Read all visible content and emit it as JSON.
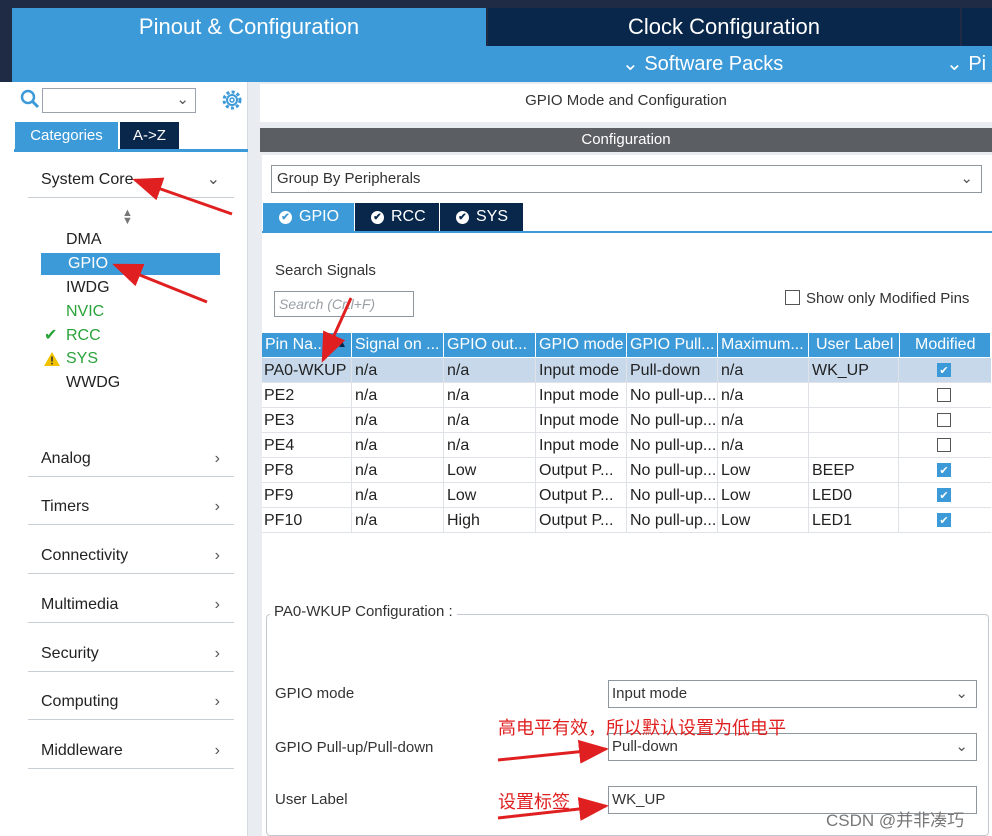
{
  "top_tabs": {
    "pinout": "Pinout & Configuration",
    "clock": "Clock Configuration"
  },
  "sub_bar": {
    "software_packs": "Software Packs",
    "more": "Pi"
  },
  "left": {
    "search_value": "",
    "cat_tabs": [
      "Categories",
      "A->Z"
    ],
    "system_core": "System Core",
    "system_core_items": [
      {
        "label": "DMA",
        "state": "normal"
      },
      {
        "label": "GPIO",
        "state": "selected"
      },
      {
        "label": "IWDG",
        "state": "normal"
      },
      {
        "label": "NVIC",
        "state": "green"
      },
      {
        "label": "RCC",
        "state": "ok"
      },
      {
        "label": "SYS",
        "state": "warning"
      },
      {
        "label": "WWDG",
        "state": "normal"
      }
    ],
    "sections": [
      "Analog",
      "Timers",
      "Connectivity",
      "Multimedia",
      "Security",
      "Computing",
      "Middleware"
    ]
  },
  "right": {
    "mode_title": "GPIO Mode and Configuration",
    "configuration": "Configuration",
    "group_by": "Group By Peripherals",
    "tabs": [
      "GPIO",
      "RCC",
      "SYS"
    ],
    "search_label": "Search Signals",
    "search_placeholder": "Search (Crtl+F)",
    "only_modified": "Show only Modified Pins",
    "table": {
      "headers": [
        "Pin Na...",
        "Signal on ...",
        "GPIO out...",
        "GPIO mode",
        "GPIO Pull...",
        "Maximum...",
        "User Label",
        "Modified"
      ],
      "rows": [
        [
          "PA0-WKUP",
          "n/a",
          "n/a",
          "Input mode",
          "Pull-down",
          "n/a",
          "WK_UP",
          true
        ],
        [
          "PE2",
          "n/a",
          "n/a",
          "Input mode",
          "No pull-up...",
          "n/a",
          "",
          false
        ],
        [
          "PE3",
          "n/a",
          "n/a",
          "Input mode",
          "No pull-up...",
          "n/a",
          "",
          false
        ],
        [
          "PE4",
          "n/a",
          "n/a",
          "Input mode",
          "No pull-up...",
          "n/a",
          "",
          false
        ],
        [
          "PF8",
          "n/a",
          "Low",
          "Output P...",
          "No pull-up...",
          "Low",
          "BEEP",
          true
        ],
        [
          "PF9",
          "n/a",
          "Low",
          "Output P...",
          "No pull-up...",
          "Low",
          "LED0",
          true
        ],
        [
          "PF10",
          "n/a",
          "High",
          "Output P...",
          "No pull-up...",
          "Low",
          "LED1",
          true
        ]
      ]
    },
    "config": {
      "legend": "PA0-WKUP Configuration :",
      "gpio_mode_label": "GPIO mode",
      "gpio_mode_value": "Input mode",
      "pull_label": "GPIO Pull-up/Pull-down",
      "pull_value": "Pull-down",
      "user_label_label": "User Label",
      "user_label_value": "WK_UP"
    }
  },
  "annotations": {
    "note_pull": "高电平有效，所以默认设置为低电平",
    "note_label": "设置标签",
    "color": "#e02020"
  },
  "watermark": "CSDN @并非凑巧"
}
